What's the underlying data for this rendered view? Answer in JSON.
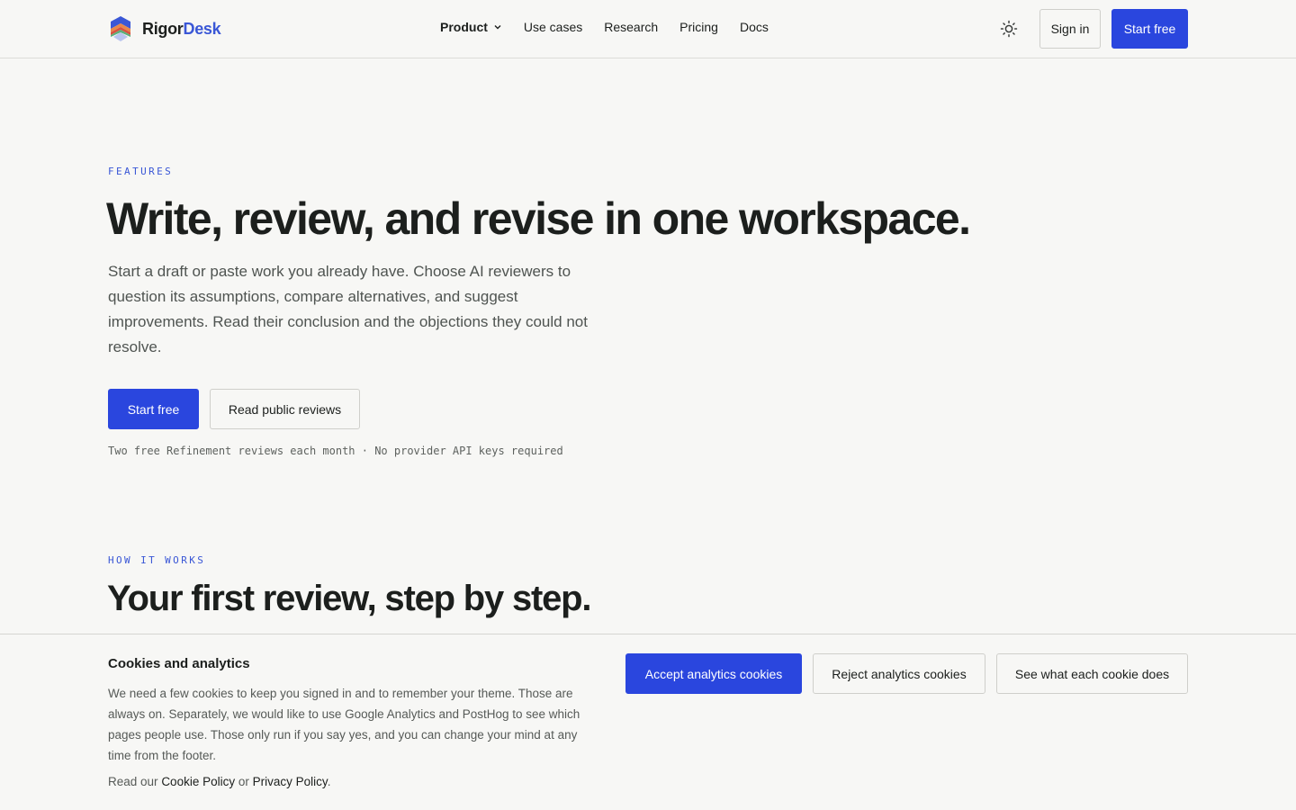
{
  "brand": {
    "name_part1": "Rigor",
    "name_part2": "Desk",
    "logo_icon": "layered-chevron-logo"
  },
  "nav": {
    "items": [
      {
        "label": "Product",
        "has_dropdown": true
      },
      {
        "label": "Use cases"
      },
      {
        "label": "Research"
      },
      {
        "label": "Pricing"
      },
      {
        "label": "Docs"
      }
    ],
    "theme_icon": "sun-icon",
    "signin_label": "Sign in",
    "start_label": "Start free"
  },
  "hero": {
    "eyebrow": "FEATURES",
    "title": "Write, review, and revise in one workspace.",
    "description": "Start a draft or paste work you already have. Choose AI reviewers to question its assumptions, compare alternatives, and suggest improvements. Read their conclusion and the objections they could not resolve.",
    "primary_cta": "Start free",
    "secondary_cta": "Read public reviews",
    "note": "Two free Refinement reviews each month · No provider API keys required"
  },
  "how": {
    "eyebrow": "HOW IT WORKS",
    "title": "Your first review, step by step."
  },
  "cookie_banner": {
    "title": "Cookies and analytics",
    "body": "We need a few cookies to keep you signed in and to remember your theme. Those are always on. Separately, we would like to use Google Analytics and PostHog to see which pages people use. Those only run if you say yes, and you can change your mind at any time from the footer.",
    "links_prefix": "Read our",
    "cookie_policy": "Cookie Policy",
    "links_or": "or",
    "privacy_policy": "Privacy Policy",
    "links_suffix": ".",
    "accept_label": "Accept analytics cookies",
    "reject_label": "Reject analytics cookies",
    "details_label": "See what each cookie does"
  },
  "colors": {
    "accent": "#2a46de",
    "brand_blue": "#3a57d6",
    "background": "#f7f7f5",
    "text": "#1c1f1d"
  }
}
